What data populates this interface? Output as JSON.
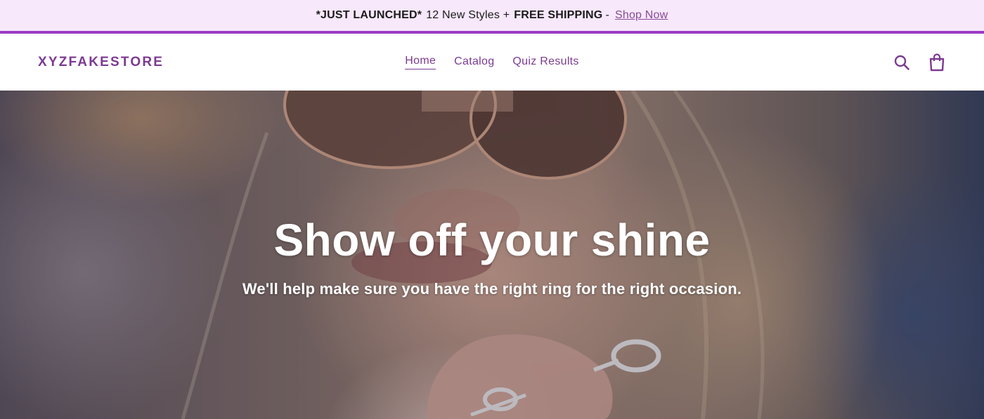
{
  "announcement": {
    "part1_bold": "*JUST LAUNCHED*",
    "part2": "12 New Styles +",
    "part3_bold": "FREE SHIPPING",
    "separator": "-",
    "link": "Shop Now"
  },
  "header": {
    "logo": "XYZFAKESTORE",
    "nav": [
      {
        "label": "Home",
        "active": true
      },
      {
        "label": "Catalog",
        "active": false
      },
      {
        "label": "Quiz Results",
        "active": false
      }
    ],
    "icons": [
      "search-icon",
      "cart-icon"
    ]
  },
  "hero": {
    "title": "Show off your shine",
    "subtitle": "We'll help make sure you have the right ring for the right occasion."
  },
  "colors": {
    "brand": "#7c3a92",
    "announcement_bg": "#f7e8fb",
    "announcement_border": "#9c3cc4"
  }
}
